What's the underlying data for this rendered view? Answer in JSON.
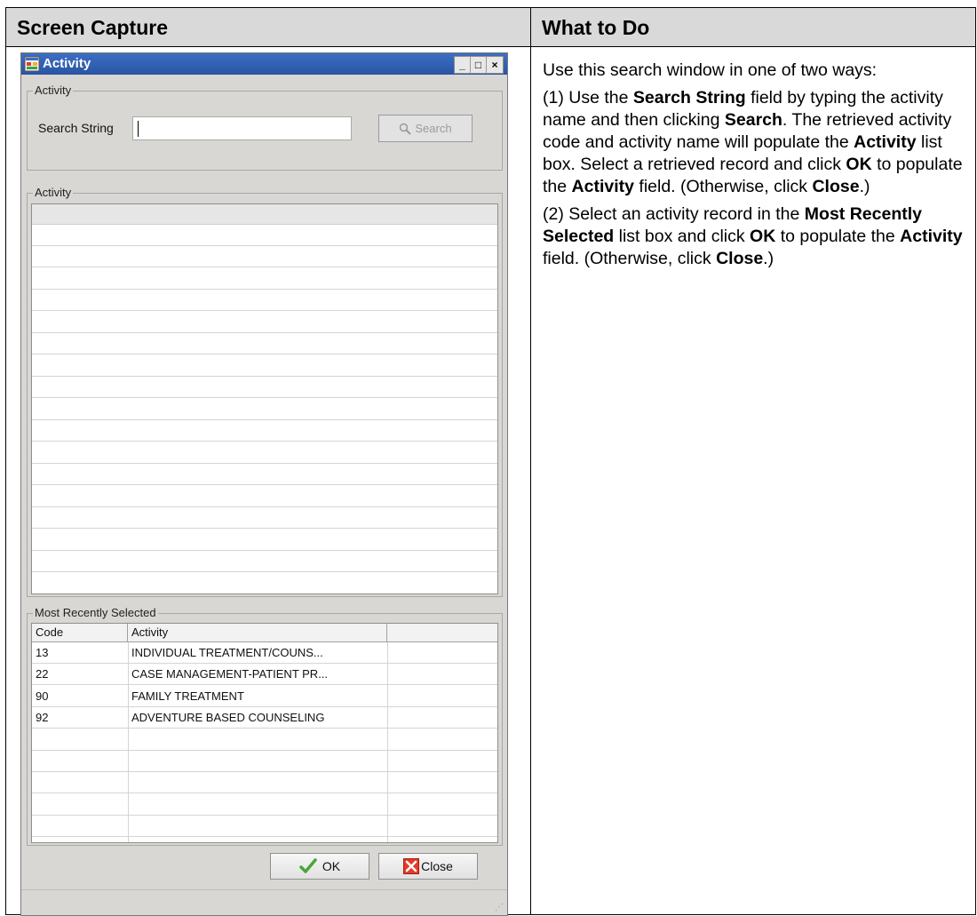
{
  "table": {
    "left_header": "Screen Capture",
    "right_header": "What to Do"
  },
  "window": {
    "title": "Activity",
    "icon": "app-window-icon",
    "controls": {
      "minimize": "_",
      "maximize": "□",
      "close": "×"
    },
    "search_group": {
      "legend": "Activity",
      "search_label": "Search String",
      "search_value": "",
      "search_button": "Search",
      "search_button_icon": "magnifier-icon"
    },
    "results_group": {
      "legend": "Activity"
    },
    "recent_group": {
      "legend": "Most Recently Selected",
      "columns": [
        "Code",
        "Activity",
        ""
      ],
      "rows": [
        {
          "code": "13",
          "activity": "INDIVIDUAL TREATMENT/COUNS..."
        },
        {
          "code": "22",
          "activity": "CASE MANAGEMENT-PATIENT PR..."
        },
        {
          "code": "90",
          "activity": "FAMILY TREATMENT"
        },
        {
          "code": "92",
          "activity": "ADVENTURE BASED COUNSELING"
        }
      ]
    },
    "ok_button": "OK",
    "ok_icon": "checkmark-icon",
    "close_button": "Close",
    "close_icon": "red-x-icon"
  },
  "instructions": {
    "p1": "Use this search window in one of two ways:",
    "p2": {
      "t1": "(1) Use the ",
      "b1": "Search String",
      "t2": " field by typing the activity name and then clicking ",
      "b2": "Search",
      "t3": ". The retrieved activity code and activity name will populate the ",
      "b3": "Activity",
      "t4": " list box. Select a retrieved record and click ",
      "b4": "OK",
      "t5": " to populate the ",
      "b5": "Activity",
      "t6": " field. (Otherwise, click ",
      "b6": "Close",
      "t7": ".)"
    },
    "p3": {
      "t1": "(2) Select an activity record in the ",
      "b1": "Most Recently Selected",
      "t2": " list box and click ",
      "b2": "OK",
      "t3": " to populate the ",
      "b3": "Activity",
      "t4": " field. (Otherwise, click ",
      "b4": "Close",
      "t5": ".)"
    }
  }
}
